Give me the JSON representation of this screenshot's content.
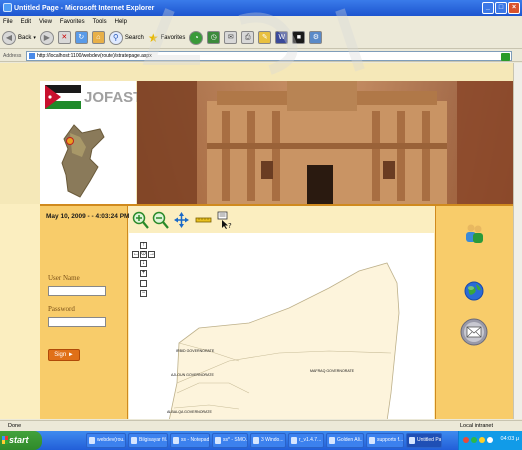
{
  "window": {
    "title": "Untitled Page - Microsoft Internet Explorer",
    "buttons": [
      "_",
      "□",
      "×"
    ]
  },
  "menu": [
    "File",
    "Edit",
    "View",
    "Favorites",
    "Tools",
    "Help"
  ],
  "toolbar": {
    "back": "Back",
    "search": "Search",
    "favorites": "Favorites"
  },
  "address": {
    "label": "Address",
    "url": "http://localhost:1100/webdev(route)/stratepage.aspx",
    "go": "Go",
    "links": "Links"
  },
  "header": {
    "logo_text": "JOFAST"
  },
  "left_panel": {
    "datetime": "May 10, 2009 - - 4:03:24 PM",
    "username_label": "User Name",
    "password_label": "Password",
    "signin_label": "Sign ►"
  },
  "map": {
    "tools": [
      "zoom-in",
      "zoom-out",
      "pan",
      "measure",
      "identify"
    ],
    "nav_buttons": [
      "↑",
      "←",
      "⊙",
      "→",
      "↓",
      "+",
      "−"
    ],
    "labels": [
      "IRBID GOVERNORATE",
      "AJLOUN GOVERNORATE",
      "MAFRAQ GOVERNORATE",
      "ALBALQA GOVERNORATE"
    ]
  },
  "right_panel": {
    "items": [
      "",
      "",
      ""
    ]
  },
  "status": {
    "left": "Done",
    "zone": "Local intranet"
  },
  "taskbar": {
    "start": "start",
    "items": [
      "webdev(rou...",
      "Bilgisayar fil...",
      "ss - Notepad",
      "ss* - SMO...",
      "3 Windo...",
      "r_v1.4.7...",
      "Golden Ali...",
      "supports f...",
      "Untitled Pa..."
    ],
    "clock": "04:03 μ"
  },
  "colors": {
    "ie_chrome": "#ece9d8",
    "page_bg": "#fbeec0",
    "panel_orange": "#f8cc6a",
    "border_orange": "#d08a1e",
    "button_orange": "#e07018",
    "taskbar_blue": "#225ed8"
  }
}
